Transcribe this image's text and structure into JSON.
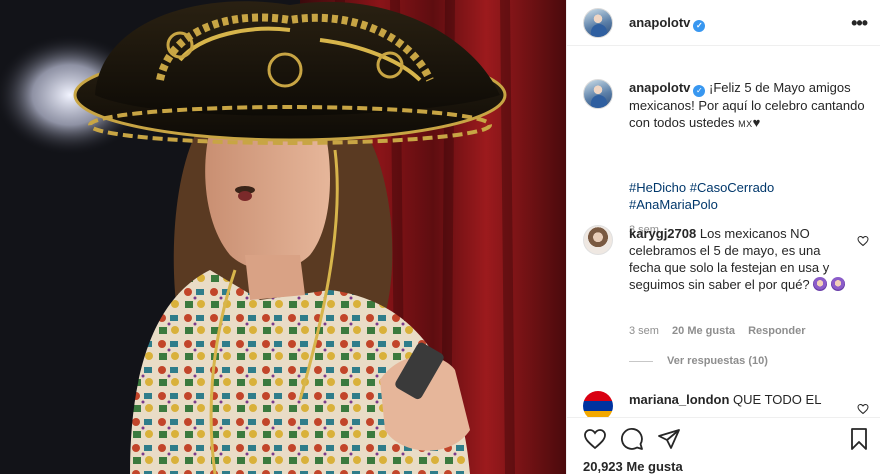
{
  "post": {
    "username": "anapolotv",
    "more_label": "•••"
  },
  "caption": {
    "username": "anapolotv",
    "text": "¡Feliz 5 de Mayo amigos mexicanos! Por aquí lo celebro cantando con todos ustedes",
    "flag": "MX",
    "heart": "♥",
    "hashtags": [
      "#HeDicho",
      "#CasoCerrado",
      "#AnaMariaPolo"
    ],
    "time": "3 sem"
  },
  "comments": [
    {
      "username": "karygj2708",
      "text": "Los mexicanos NO celebramos el 5 de mayo, es una fecha que solo la festejan en usa y seguimos sin saber el por qué?",
      "time": "3 sem",
      "likes": "20 Me gusta",
      "reply": "Responder",
      "view_replies": "Ver respuestas (10)"
    },
    {
      "username": "mariana_london",
      "text": "QUE TODO EL"
    }
  ],
  "footer": {
    "likes": "20,923 Me gusta"
  },
  "icons": {
    "verified": "verified-badge-icon",
    "like": "heart-icon",
    "comment": "comment-icon",
    "share": "paper-plane-icon",
    "save": "bookmark-icon"
  }
}
